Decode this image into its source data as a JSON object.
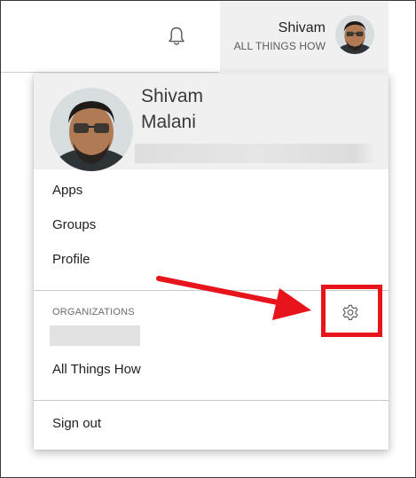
{
  "topbar": {
    "bell_icon": "bell-icon"
  },
  "account": {
    "name": "Shivam",
    "org": "ALL THINGS HOW"
  },
  "menu": {
    "first_name": "Shivam",
    "last_name": "Malani",
    "items": [
      {
        "label": "Apps"
      },
      {
        "label": "Groups"
      },
      {
        "label": "Profile"
      }
    ],
    "organizations_label": "ORGANIZATIONS",
    "organization_name": "All Things How",
    "settings_icon": "gear-icon",
    "sign_out_label": "Sign out"
  },
  "annotation": {
    "color": "#e8141c"
  },
  "colors": {
    "header_bg": "#f0f0f0",
    "separator": "#c9c9c9"
  }
}
